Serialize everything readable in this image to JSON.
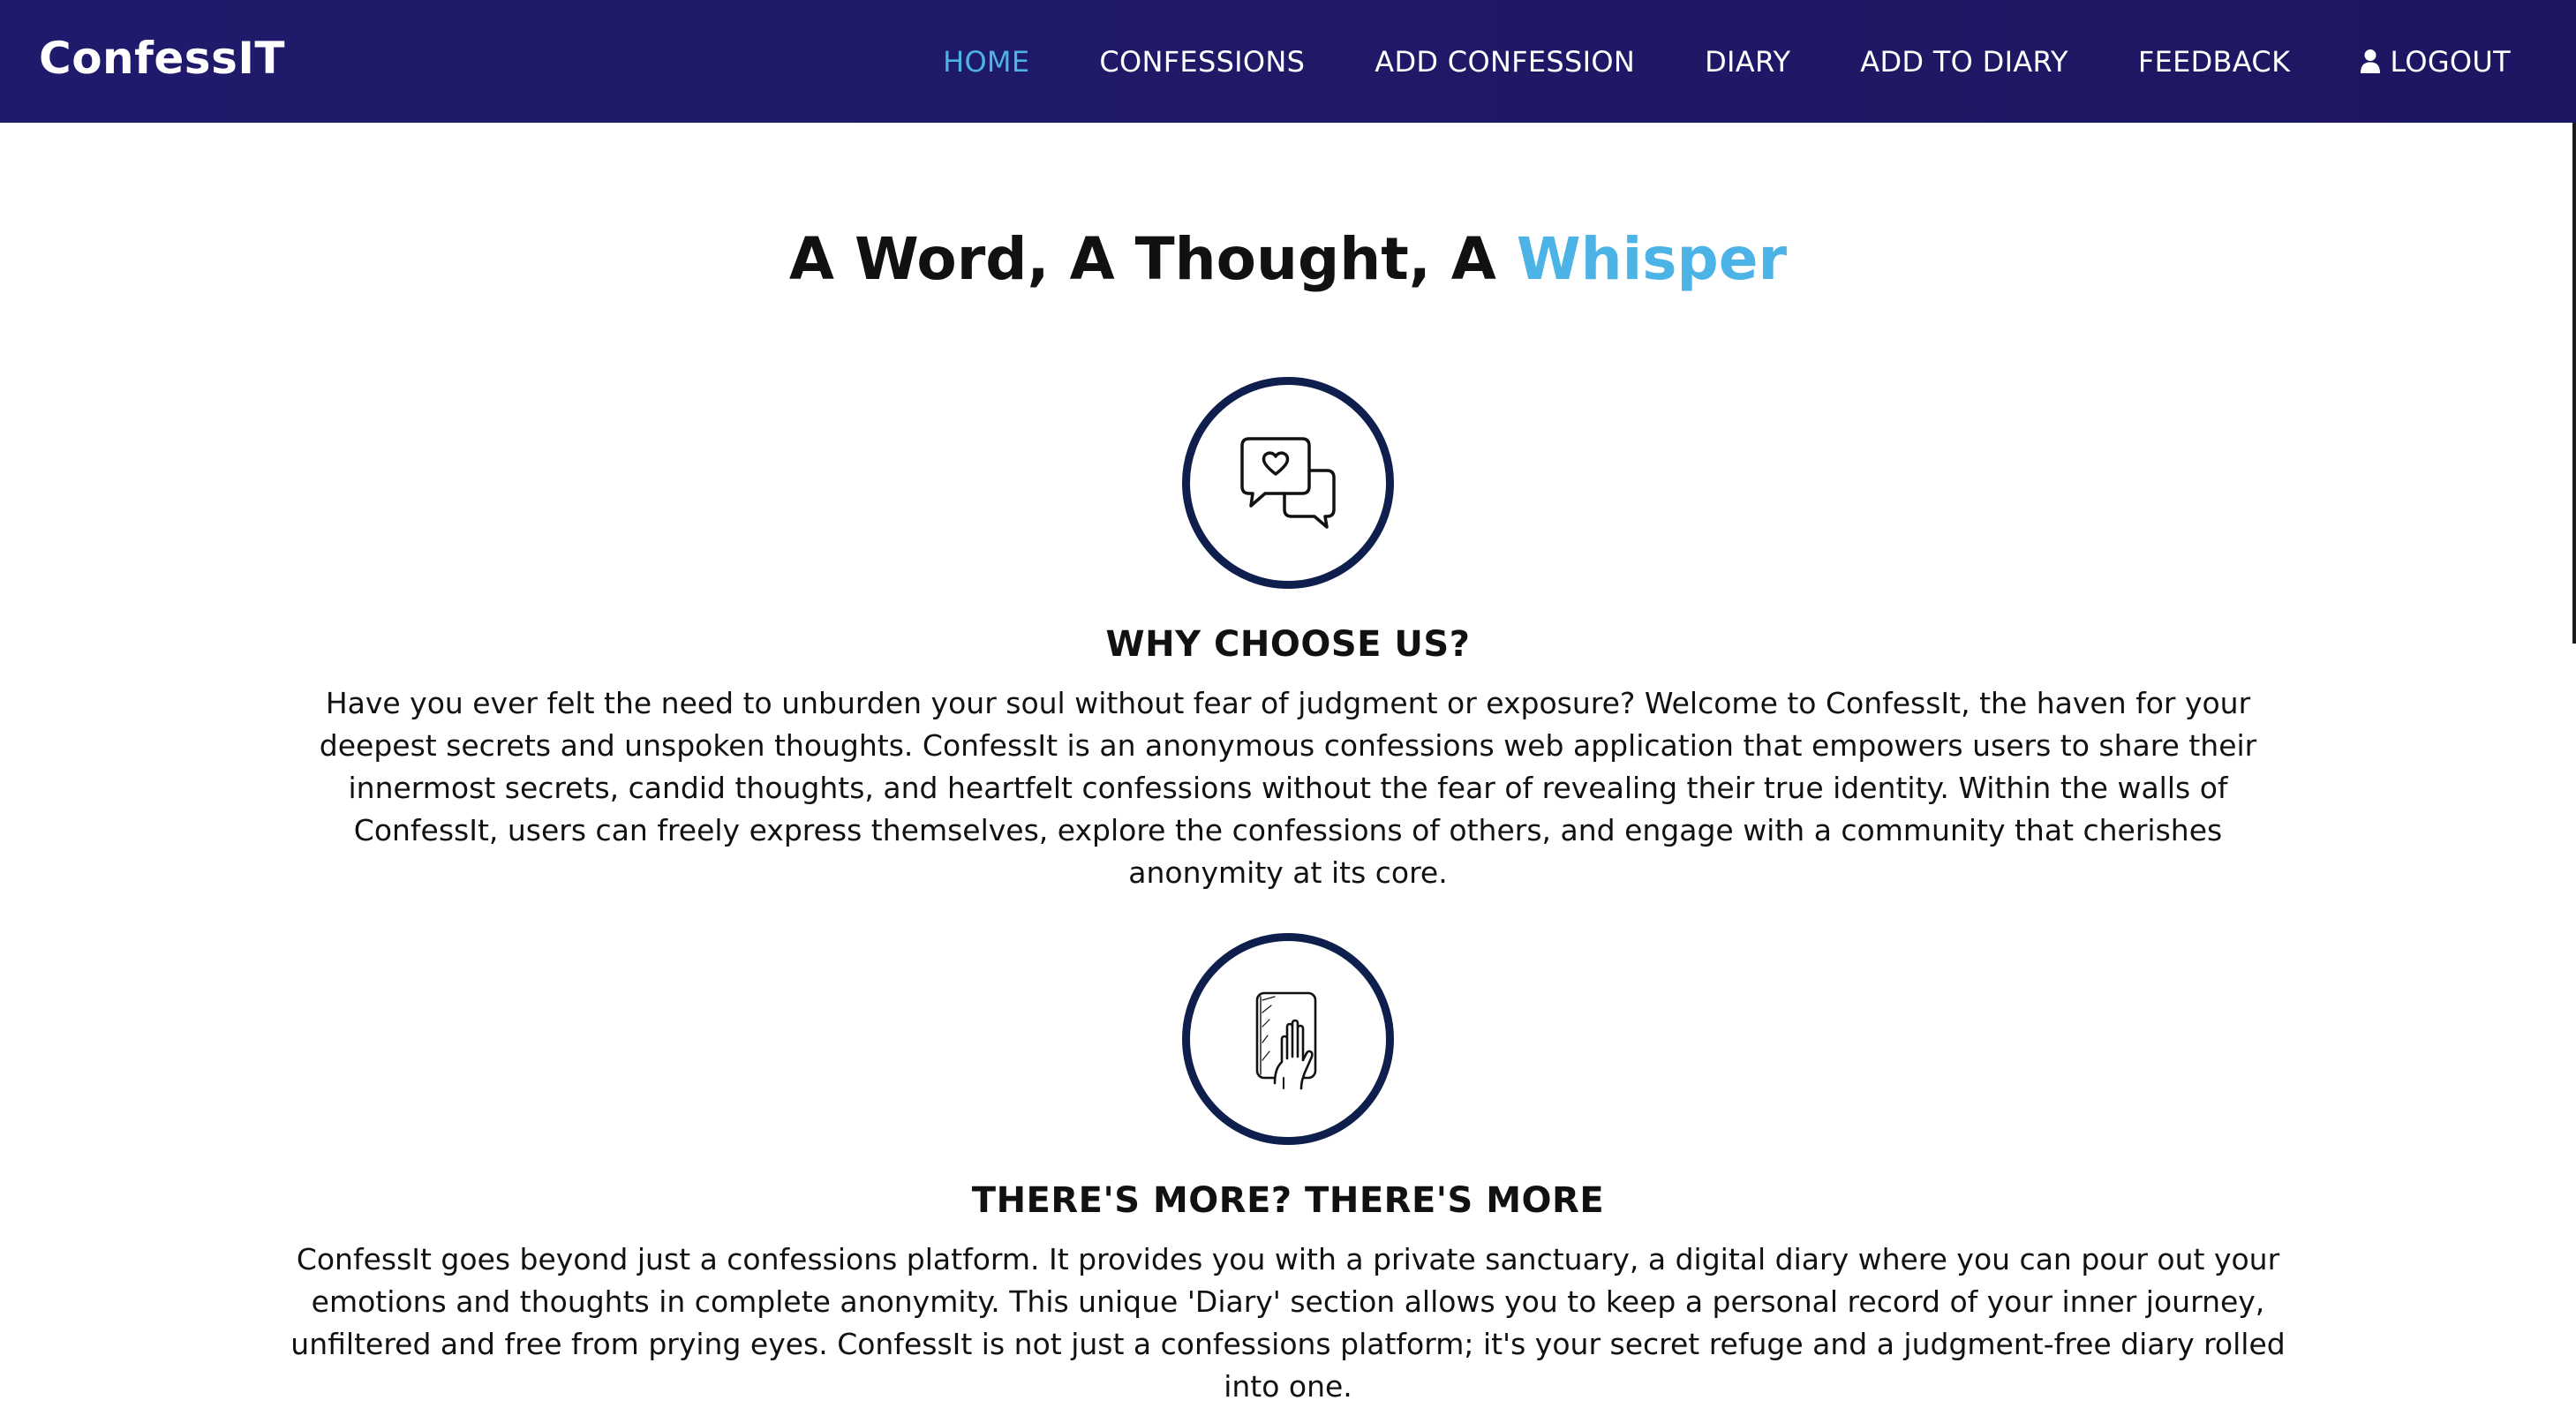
{
  "navbar": {
    "brand": "ConfessIT",
    "links": [
      {
        "label": "HOME",
        "active": true
      },
      {
        "label": "CONFESSIONS",
        "active": false
      },
      {
        "label": "ADD CONFESSION",
        "active": false
      },
      {
        "label": "DIARY",
        "active": false
      },
      {
        "label": "ADD TO DIARY",
        "active": false
      },
      {
        "label": "FEEDBACK",
        "active": false
      },
      {
        "label": "LOGOUT",
        "active": false,
        "icon": "user-icon"
      }
    ]
  },
  "hero": {
    "title_main": "A Word, A Thought, A ",
    "title_accent": "Whisper"
  },
  "features": [
    {
      "icon": "chat-bubbles-heart-icon",
      "heading": "WHY CHOOSE US?",
      "text": "Have you ever felt the need to unburden your soul without fear of judgment or exposure? Welcome to ConfessIt, the haven for your deepest secrets and unspoken thoughts. ConfessIt is an anonymous confessions web application that empowers users to share their innermost secrets, candid thoughts, and heartfelt confessions without the fear of revealing their true identity. Within the walls of ConfessIt, users can freely express themselves, explore the confessions of others, and engage with a community that cherishes anonymity at its core."
    },
    {
      "icon": "hand-on-book-icon",
      "heading": "THERE'S MORE? THERE'S MORE",
      "text": "ConfessIt goes beyond just a confessions platform. It provides you with a private sanctuary, a digital diary where you can pour out your emotions and thoughts in complete anonymity. This unique 'Diary' section allows you to keep a personal record of your inner journey, unfiltered and free from prying eyes. ConfessIt is not just a confessions platform; it's your secret refuge and a judgment-free diary rolled into one."
    }
  ],
  "colors": {
    "navbar": "#201a6c",
    "accent": "#4bb3e6",
    "icon_ring": "#0f1f4d",
    "text": "#111111"
  }
}
